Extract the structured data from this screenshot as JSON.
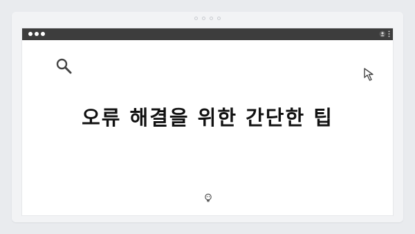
{
  "window": {
    "controls": [
      "close",
      "minimize",
      "zoom"
    ],
    "titlebar_icons": [
      "user-icon",
      "kebab-menu-icon"
    ]
  },
  "frame": {
    "dots": 4
  },
  "content": {
    "headline": "오류 해결을 위한 간단한 팁",
    "icons": [
      "search-icon",
      "cursor-arrow-icon",
      "lightbulb-icon"
    ]
  },
  "colors": {
    "titlebar": "#3d3d3d",
    "background": "#e9ebee",
    "canvas": "#ffffff",
    "text": "#111111"
  }
}
